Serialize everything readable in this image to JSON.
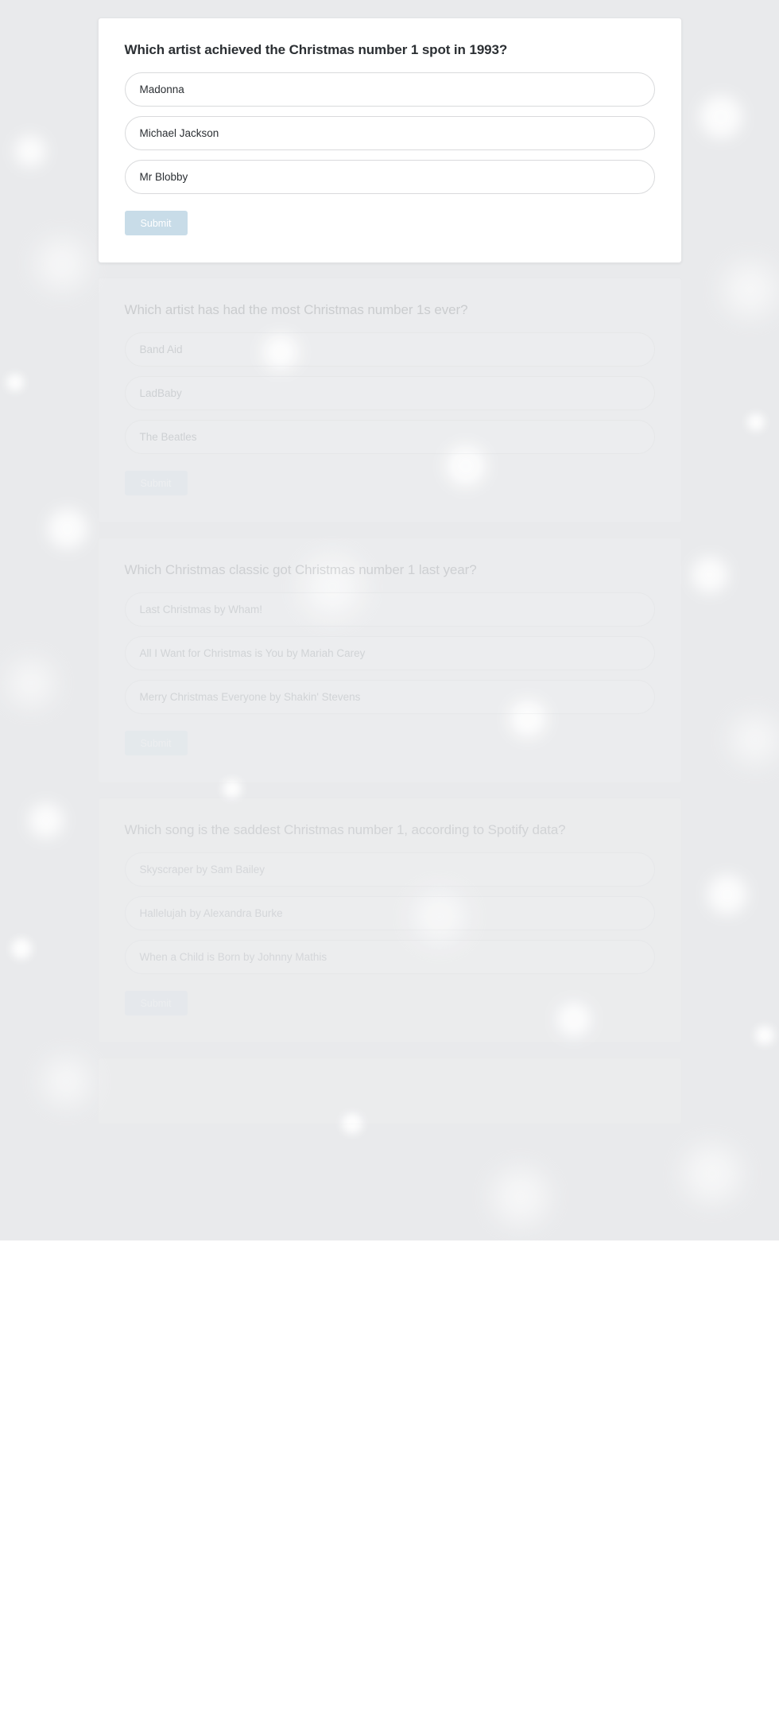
{
  "quiz": {
    "submit_label": "Submit",
    "cards": [
      {
        "state": "active",
        "question": "Which artist achieved the Christmas number 1 spot in 1993?",
        "options": [
          "Madonna",
          "Michael Jackson",
          "Mr Blobby"
        ]
      },
      {
        "state": "faded",
        "question": "Which artist has had the most Christmas number 1s ever?",
        "options": [
          "Band Aid",
          "LadBaby",
          "The Beatles"
        ]
      },
      {
        "state": "faded",
        "question": "Which Christmas classic got Christmas number 1 last year?",
        "options": [
          "Last Christmas by Wham!",
          "All I Want for Christmas is You by Mariah Carey",
          "Merry Christmas Everyone by Shakin' Stevens"
        ]
      },
      {
        "state": "faded",
        "question": "Which song is the saddest Christmas number 1, according to Spotify data?",
        "options": [
          "Skyscraper by Sam Bailey",
          "Hallelujah by Alexandra Burke",
          "When a Child is Born by Johnny Mathis"
        ]
      }
    ]
  },
  "colors": {
    "page_background": "#e9eaec",
    "card_background": "#ffffff",
    "card_border": "#e3e4e6",
    "option_border": "#d9dadc",
    "question_text": "#2b2f33",
    "faded_text": "#8f9397",
    "submit_background": "#c8dce8",
    "submit_text": "#ffffff"
  }
}
